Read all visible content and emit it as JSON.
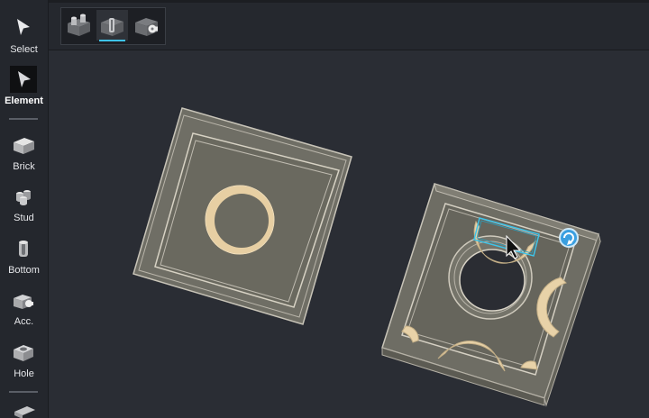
{
  "sidebar": {
    "items": [
      {
        "label": "Select",
        "icon": "cursor-icon",
        "active": false
      },
      {
        "label": "Element",
        "icon": "cursor-filled-icon",
        "active": true
      },
      {
        "label": "Brick",
        "icon": "brick-icon",
        "active": false
      },
      {
        "label": "Stud",
        "icon": "stud-icon",
        "active": false
      },
      {
        "label": "Bottom",
        "icon": "bottom-icon",
        "active": false
      },
      {
        "label": "Acc.",
        "icon": "accessory-icon",
        "active": false
      },
      {
        "label": "Hole",
        "icon": "hole-icon",
        "active": false
      }
    ]
  },
  "toolbar": {
    "buttons": [
      {
        "icon": "studs-view-icon",
        "active": false
      },
      {
        "icon": "bottom-view-icon",
        "active": true
      },
      {
        "icon": "accessory-view-icon",
        "active": false
      }
    ]
  },
  "colors": {
    "accent": "#3ec3e8",
    "brick_face": "#6e6d64",
    "tube": "#e8d2a8",
    "background": "#2a2d34"
  }
}
